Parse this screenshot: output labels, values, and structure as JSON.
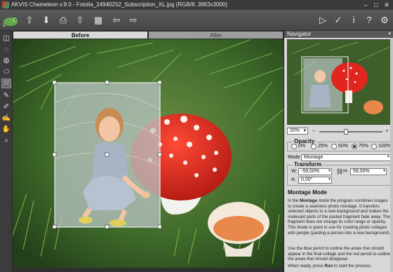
{
  "window": {
    "title": "AKVIS Chameleon v.9.0 - Fotolia_24940252_Subscription_XL.jpg (RGB/8, 3963x3000)",
    "minimize": "–",
    "maximize": "□",
    "close": "✕"
  },
  "toolbar": {
    "icons": [
      "open-icon",
      "save-icon",
      "print-icon",
      "share-icon",
      "grid-icon",
      "undo-icon",
      "redo-icon",
      "run-icon",
      "apply-icon",
      "info-icon",
      "help-icon",
      "settings-icon"
    ],
    "glyphs": {
      "open": "⇪",
      "save": "⬇",
      "print": "⎙",
      "share": "⇧",
      "grid": "▦",
      "back": "⇦",
      "forward": "⇨",
      "run": "▷",
      "apply": "✓",
      "info": "ⅰ",
      "help": "?",
      "settings": "⚙"
    }
  },
  "tools": [
    "◫",
    "◌",
    "◍",
    "⬭",
    "⤧",
    "✎",
    "✐",
    "✍",
    "✋",
    "⌕"
  ],
  "tabs": {
    "before": "Before",
    "after": "After"
  },
  "navigator": {
    "header": "Navigator",
    "collapse": "▾",
    "zoom": "20%",
    "minus": "–",
    "plus": "+",
    "zoom_level": 0.42
  },
  "opacity": {
    "title": "Opacity",
    "options": [
      "0%",
      "25%",
      "50%",
      "75%",
      "100%"
    ],
    "selected": "75%"
  },
  "mode": {
    "label": "Mode",
    "value": "Montage",
    "arrow": "▾"
  },
  "transform": {
    "title": "Transform",
    "w_label": "W:",
    "w_value": "-59,00%",
    "h_label": "H:",
    "h_value": "59,00%",
    "a_label": "A:",
    "a_value": "0,00°",
    "arrow": "▾",
    "link_icon": "⛓"
  },
  "help": {
    "title": "Montage Mode",
    "p1_a": "In the ",
    "p1_b": "Montage",
    "p1_c": " mode the program combines images to create a seamless photo montage. It transfers selected objects to a new background and makes the irrelevant parts of the pasted fragment fade away. The fragment does not change its color range or opacity. This mode is good to use for creating photo collages with people (pasting a person into a new background).",
    "p2": "Use the blue pencil to outline the areas that should appear in the final collage and the red pencil to outline the areas that should disappear.",
    "p3_a": "When ready, press ",
    "p3_b": "Run",
    "p3_c": " to start the process."
  },
  "colors": {
    "mushroom_red": "#e0261f",
    "grass": "#4e7a2e",
    "selection_border": "#ffffff"
  }
}
